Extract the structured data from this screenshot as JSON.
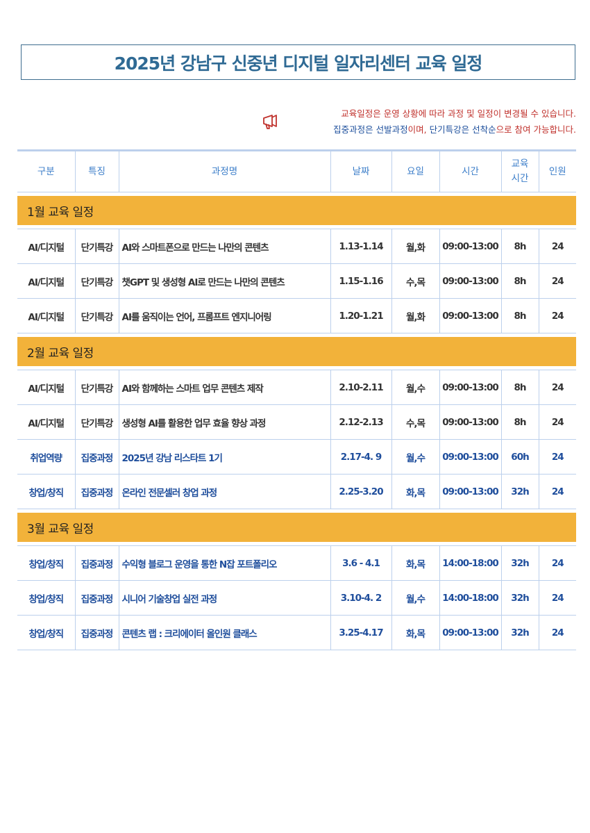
{
  "title": "2025년 강남구 신중년 디지털 일자리센터 교육 일정",
  "notice": {
    "line1": "교육일정은 운영 상황에 따라 과정 및 일정이 변경될 수 있습니다.",
    "line2_a": "집중과정은 선발과정",
    "line2_b": "이며, ",
    "line2_c": "단기특강은 선착순",
    "line2_d": "으로 참여 가능합니다."
  },
  "headers": {
    "category": "구분",
    "feature": "특징",
    "course": "과정명",
    "date": "날짜",
    "day": "요일",
    "time": "시간",
    "hours_1": "교육",
    "hours_2": "시간",
    "people": "인원"
  },
  "months": [
    {
      "label": "1월 교육 일정",
      "rows": [
        {
          "category": "AI/디지털",
          "feature": "단기특강",
          "course": "AI와 스마트폰으로 만드는 나만의 콘텐츠",
          "date": "1.13-1.14",
          "day": "월,화",
          "time": "09:00-13:00",
          "hours": "8h",
          "people": "24",
          "style": "dark"
        },
        {
          "category": "AI/디지털",
          "feature": "단기특강",
          "course": "챗GPT 및 생성형 AI로 만드는 나만의 콘텐츠",
          "date": "1.15-1.16",
          "day": "수,목",
          "time": "09:00-13:00",
          "hours": "8h",
          "people": "24",
          "style": "dark"
        },
        {
          "category": "AI/디지털",
          "feature": "단기특강",
          "course": "AI를 움직이는 언어, 프롬프트 엔지니어링",
          "date": "1.20-1.21",
          "day": "월,화",
          "time": "09:00-13:00",
          "hours": "8h",
          "people": "24",
          "style": "dark"
        }
      ]
    },
    {
      "label": "2월 교육 일정",
      "rows": [
        {
          "category": "AI/디지털",
          "feature": "단기특강",
          "course": "AI와 함께하는 스마트 업무 콘텐츠 제작",
          "date": "2.10-2.11",
          "day": "월,수",
          "time": "09:00-13:00",
          "hours": "8h",
          "people": "24",
          "style": "dark"
        },
        {
          "category": "AI/디지털",
          "feature": "단기특강",
          "course": "생성형 AI를 활용한 업무 효율 향상 과정",
          "date": "2.12-2.13",
          "day": "수,목",
          "time": "09:00-13:00",
          "hours": "8h",
          "people": "24",
          "style": "dark"
        },
        {
          "category": "취업역량",
          "feature": "집중과정",
          "course": "2025년 강남 리스타트 1기",
          "date": "2.17-4. 9",
          "day": "월,수",
          "time": "09:00-13:00",
          "hours": "60h",
          "people": "24",
          "style": "blue"
        },
        {
          "category": "창업/창직",
          "feature": "집중과정",
          "course": "온라인 전문셀러 창업 과정",
          "date": "2.25-3.20",
          "day": "화,목",
          "time": "09:00-13:00",
          "hours": "32h",
          "people": "24",
          "style": "blue"
        }
      ]
    },
    {
      "label": "3월 교육 일정",
      "rows": [
        {
          "category": "창업/창직",
          "feature": "집중과정",
          "course": "수익형 블로그 운영을 통한 N잡 포트폴리오",
          "date": "3.6 - 4.1",
          "day": "화,목",
          "time": "14:00-18:00",
          "hours": "32h",
          "people": "24",
          "style": "blue"
        },
        {
          "category": "창업/창직",
          "feature": "집중과정",
          "course": "시니어 기술창업 실전 과정",
          "date": "3.10-4. 2",
          "day": "월,수",
          "time": "14:00-18:00",
          "hours": "32h",
          "people": "24",
          "style": "blue"
        },
        {
          "category": "창업/창직",
          "feature": "집중과정",
          "course": "콘텐츠 랩 : 크리에이터 올인원 클래스",
          "date": "3.25-4.17",
          "day": "화,목",
          "time": "09:00-13:00",
          "hours": "32h",
          "people": "24",
          "style": "blue"
        }
      ]
    }
  ],
  "colors": {
    "month_bar": "#f2b23a",
    "blue_text": "#1f4e9c",
    "header_text": "#3c7ec9",
    "notice_red": "#c0312c"
  }
}
